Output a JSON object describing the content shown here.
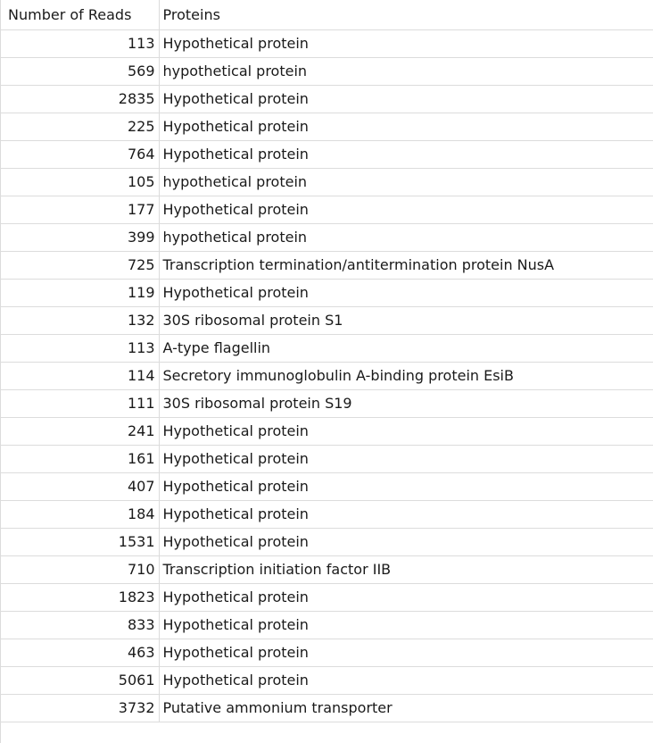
{
  "sheet": {
    "headers": {
      "reads": "Number of Reads",
      "proteins": "Proteins"
    },
    "rows": [
      {
        "reads": "113",
        "protein": "Hypothetical protein"
      },
      {
        "reads": "569",
        "protein": "hypothetical protein"
      },
      {
        "reads": "2835",
        "protein": "Hypothetical protein"
      },
      {
        "reads": "225",
        "protein": "Hypothetical protein"
      },
      {
        "reads": "764",
        "protein": "Hypothetical protein"
      },
      {
        "reads": "105",
        "protein": "hypothetical protein"
      },
      {
        "reads": "177",
        "protein": "Hypothetical protein"
      },
      {
        "reads": "399",
        "protein": "hypothetical protein"
      },
      {
        "reads": "725",
        "protein": "Transcription termination/antitermination protein NusA"
      },
      {
        "reads": "119",
        "protein": "Hypothetical protein"
      },
      {
        "reads": "132",
        "protein": "30S ribosomal protein S1"
      },
      {
        "reads": "113",
        "protein": "A-type flagellin"
      },
      {
        "reads": "114",
        "protein": "Secretory immunoglobulin A-binding protein EsiB"
      },
      {
        "reads": "111",
        "protein": "30S ribosomal protein S19"
      },
      {
        "reads": "241",
        "protein": "Hypothetical protein"
      },
      {
        "reads": "161",
        "protein": "Hypothetical protein"
      },
      {
        "reads": "407",
        "protein": "Hypothetical protein"
      },
      {
        "reads": "184",
        "protein": "Hypothetical protein"
      },
      {
        "reads": "1531",
        "protein": "Hypothetical protein"
      },
      {
        "reads": "710",
        "protein": "Transcription initiation factor IIB"
      },
      {
        "reads": "1823",
        "protein": "Hypothetical protein"
      },
      {
        "reads": "833",
        "protein": "Hypothetical protein"
      },
      {
        "reads": "463",
        "protein": "Hypothetical protein"
      },
      {
        "reads": "5061",
        "protein": "Hypothetical protein"
      },
      {
        "reads": "3732",
        "protein": "Putative ammonium transporter"
      }
    ]
  }
}
